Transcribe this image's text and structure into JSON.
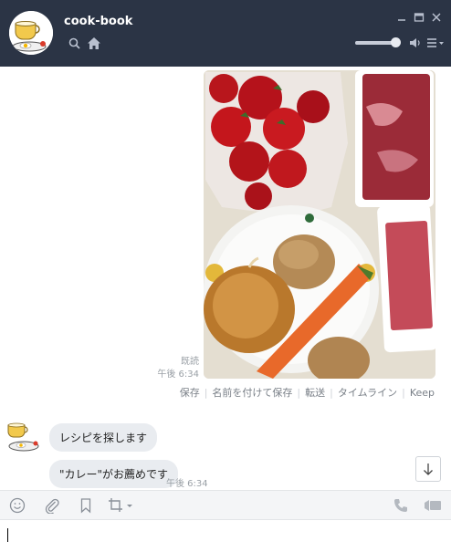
{
  "window": {
    "title": "cook-book"
  },
  "message": {
    "read_status": "既読",
    "time": "午後 6:34",
    "actions": [
      "保存",
      "名前を付けて保存",
      "転送",
      "タイムライン",
      "Keep"
    ]
  },
  "bot": {
    "bubbles": [
      "レシピを探します",
      "\"カレー\"がお薦めです"
    ],
    "time": "午後 6:34"
  },
  "volume": {
    "level": 0.88
  },
  "colors": {
    "titlebar": "#2b3445",
    "bubble": "#e9ecf0",
    "meta_text": "#9aa0a6"
  },
  "icons": [
    "search-icon",
    "home-icon",
    "minimize-icon",
    "maximize-icon",
    "close-icon",
    "speaker-icon",
    "menu-icon",
    "emoji-icon",
    "attach-icon",
    "bookmark-icon",
    "crop-icon",
    "phone-icon",
    "video-icon",
    "arrow-down-icon"
  ]
}
